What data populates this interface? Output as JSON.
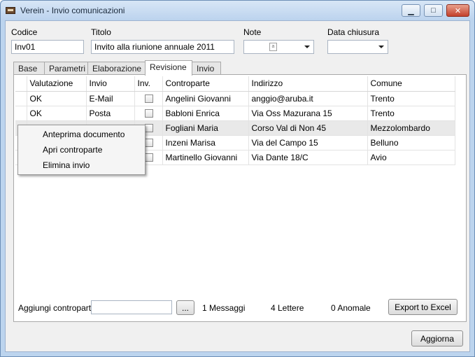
{
  "window": {
    "title": "Verein - Invio comunicazioni",
    "minimize_glyph": "▁",
    "maximize_glyph": "□",
    "close_glyph": "✕"
  },
  "header": {
    "codice_label": "Codice",
    "codice_value": "Inv01",
    "titolo_label": "Titolo",
    "titolo_value": "Invito alla riunione annuale 2011",
    "note_label": "Note",
    "note_icon": "document-icon",
    "note_icon_glyph": "a",
    "data_label": "Data chiusura",
    "data_value": ""
  },
  "tabs": [
    {
      "label": "Base"
    },
    {
      "label": "Parametri"
    },
    {
      "label": "Elaborazione"
    },
    {
      "label": "Revisione",
      "active": true
    },
    {
      "label": "Invio"
    }
  ],
  "table": {
    "columns": [
      "Valutazione",
      "Invio",
      "Inv.",
      "Controparte",
      "Indirizzo",
      "Comune"
    ],
    "rows": [
      {
        "valutazione": "OK",
        "invio": "E-Mail",
        "inv": false,
        "controparte": "Angelini Giovanni",
        "indirizzo": "anggio@aruba.it",
        "comune": "Trento"
      },
      {
        "valutazione": "OK",
        "invio": "Posta",
        "inv": false,
        "controparte": "Babloni Enrica",
        "indirizzo": "Via Oss Mazurana 15",
        "comune": "Trento"
      },
      {
        "valutazione": "",
        "invio": "",
        "inv": false,
        "controparte": "Fogliani Maria",
        "indirizzo": "Corso Val di Non 45",
        "comune": "Mezzolombardo",
        "selected": true
      },
      {
        "valutazione": "",
        "invio": "",
        "inv": false,
        "controparte": "Inzeni Marisa",
        "indirizzo": "Via del Campo 15",
        "comune": "Belluno"
      },
      {
        "valutazione": "",
        "invio": "",
        "inv": false,
        "controparte": "Martinello Giovanni",
        "indirizzo": "Via Dante 18/C",
        "comune": "Avio"
      }
    ]
  },
  "context_menu": {
    "items": [
      "Anteprima documento",
      "Apri controparte",
      "Elimina invio"
    ]
  },
  "footer": {
    "aggiungi_label": "Aggiungi controparti",
    "aggiungi_value": "",
    "browse_label": "...",
    "messaggi": "1 Messaggi",
    "lettere": "4 Lettere",
    "anomale": "0 Anomale",
    "export_label": "Export to Excel",
    "aggiorna_label": "Aggiorna"
  },
  "colors": {
    "title_bar": "#bcd3ee",
    "close_button": "#c3402c",
    "window_bg": "#f0f0f0",
    "selected_row": "#e9e9e9"
  }
}
